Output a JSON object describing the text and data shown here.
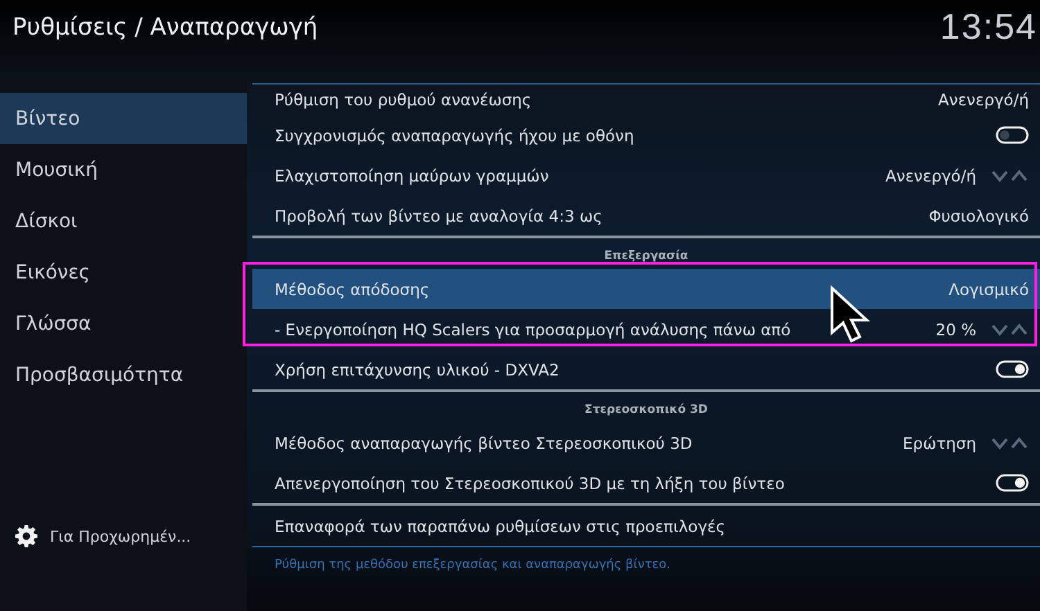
{
  "header": {
    "title": "Ρυθμίσεις / Αναπαραγωγή",
    "clock": "13:54"
  },
  "sidebar": {
    "items": [
      {
        "label": "Βίντεο",
        "selected": true
      },
      {
        "label": "Μουσική",
        "selected": false
      },
      {
        "label": "Δίσκοι",
        "selected": false
      },
      {
        "label": "Εικόνες",
        "selected": false
      },
      {
        "label": "Γλώσσα",
        "selected": false
      },
      {
        "label": "Προσβασιμότητα",
        "selected": false
      }
    ],
    "level_button": "Για Προχωρημέν..."
  },
  "settings": [
    {
      "kind": "value",
      "label": "Ρύθμιση του ρυθμού ανανέωσης",
      "value": "Ανενεργό/ή",
      "selected": false
    },
    {
      "kind": "toggle",
      "label": "Συγχρονισμός αναπαραγωγής ήχου με οθόνη",
      "on": false,
      "selected": false
    },
    {
      "kind": "spinner",
      "label": "Ελαχιστοποίηση μαύρων γραμμών",
      "value": "Ανενεργό/ή",
      "selected": false
    },
    {
      "kind": "value",
      "label": "Προβολή των βίντεο με αναλογία 4:3 ως",
      "value": "Φυσιολογικό",
      "selected": false
    },
    {
      "kind": "header",
      "label": "Επεξεργασία"
    },
    {
      "kind": "value",
      "label": "Μέθοδος απόδοσης",
      "value": "Λογισμικό",
      "selected": true
    },
    {
      "kind": "spinner",
      "label": "- Ενεργοποίηση HQ Scalers για προσαρμογή ανάλυσης πάνω από",
      "value": "20 %",
      "selected": false
    },
    {
      "kind": "toggle",
      "label": "Χρήση επιτάχυνσης υλικού - DXVA2",
      "on": true,
      "selected": false
    },
    {
      "kind": "header",
      "label": "Στερεοσκοπικό 3D"
    },
    {
      "kind": "spinner",
      "label": "Μέθοδος αναπαραγωγής βίντεο Στερεοσκοπικού 3D",
      "value": "Ερώτηση",
      "selected": false
    },
    {
      "kind": "toggle",
      "label": "Απενεργοποίηση του Στερεοσκοπικού 3D με τη λήξη του βίντεο",
      "on": true,
      "selected": false
    },
    {
      "kind": "action",
      "label": "Επαναφορά των παραπάνω ρυθμίσεων στις προεπιλογές",
      "selected": false
    }
  ],
  "hint": "Ρύθμιση της μεθόδου επεξεργασίας και αναπαραγωγής βίντεο."
}
